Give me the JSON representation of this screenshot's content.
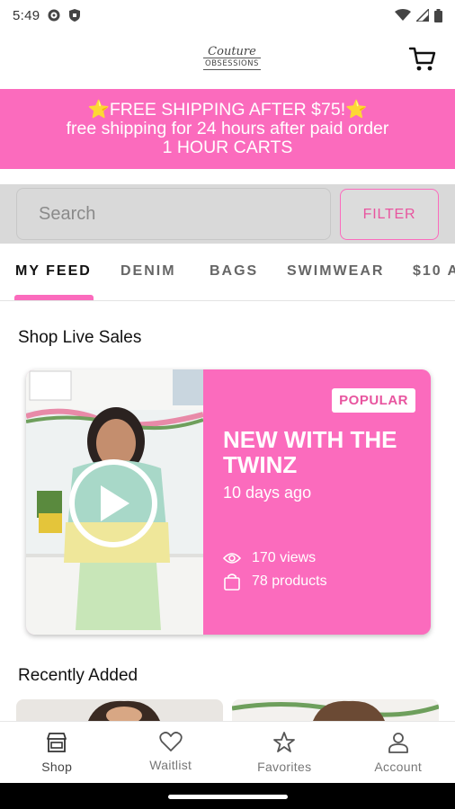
{
  "status_bar": {
    "time": "5:49",
    "left_icons": [
      "gear-icon",
      "shield-icon"
    ],
    "right_icons": [
      "wifi-icon",
      "signal-icon",
      "battery-icon"
    ]
  },
  "header": {
    "logo_script": "Couture",
    "logo_word": "OBSESSIONS",
    "cart_icon": "cart-icon"
  },
  "promo": {
    "line1": "⭐FREE SHIPPING AFTER $75!⭐",
    "line2": "free shipping for 24 hours after paid order",
    "line3": "1 HOUR CARTS",
    "bg_color": "#fb6bbd"
  },
  "search": {
    "placeholder": "Search",
    "filter_label": "FILTER"
  },
  "tabs": [
    {
      "label": "MY FEED",
      "active": true
    },
    {
      "label": "DENIM"
    },
    {
      "label": "BAGS"
    },
    {
      "label": "SWIMWEAR"
    },
    {
      "label": "$10 A"
    }
  ],
  "live_sales": {
    "section_title": "Shop Live Sales",
    "card": {
      "badge": "POPULAR",
      "title": "NEW WITH THE TWINZ",
      "time_ago": "10 days ago",
      "views": "170 views",
      "products": "78 products"
    }
  },
  "recent": {
    "section_title": "Recently Added"
  },
  "bottom_nav": [
    {
      "label": "Shop",
      "icon": "shop-icon",
      "active": true
    },
    {
      "label": "Waitlist",
      "icon": "heart-icon"
    },
    {
      "label": "Favorites",
      "icon": "star-icon"
    },
    {
      "label": "Account",
      "icon": "account-icon"
    }
  ]
}
